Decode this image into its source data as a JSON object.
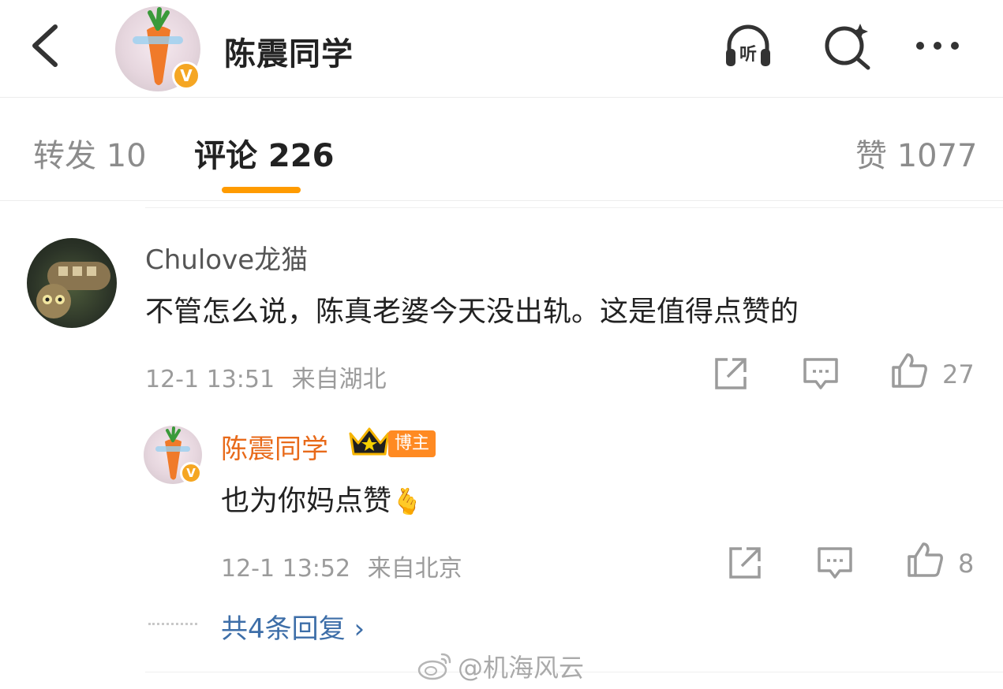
{
  "header": {
    "title": "陈震同学",
    "badge": "V",
    "icons": [
      "back-icon",
      "listen-icon",
      "search-sparkle-icon",
      "more-icon"
    ],
    "listen_label": "听"
  },
  "tabs": [
    {
      "label": "转发 10"
    },
    {
      "label": "评论 226"
    },
    {
      "label": "赞 1077"
    }
  ],
  "accent_color": "#ff9b00",
  "comment": {
    "username": "Chulove龙猫",
    "text": "不管怎么说，陈真老婆今天没出轨。这是值得点赞的",
    "time": "12-1 13:51",
    "location": "来自湖北",
    "likes": "27"
  },
  "reply": {
    "username": "陈震同学",
    "tag": "博主",
    "badge": "V",
    "text": "也为你妈点赞",
    "emoji": "🫰",
    "time": "12-1 13:52",
    "location": "来自北京",
    "likes": "8"
  },
  "more_replies": "共4条回复 ›",
  "watermark": "@机海风云"
}
